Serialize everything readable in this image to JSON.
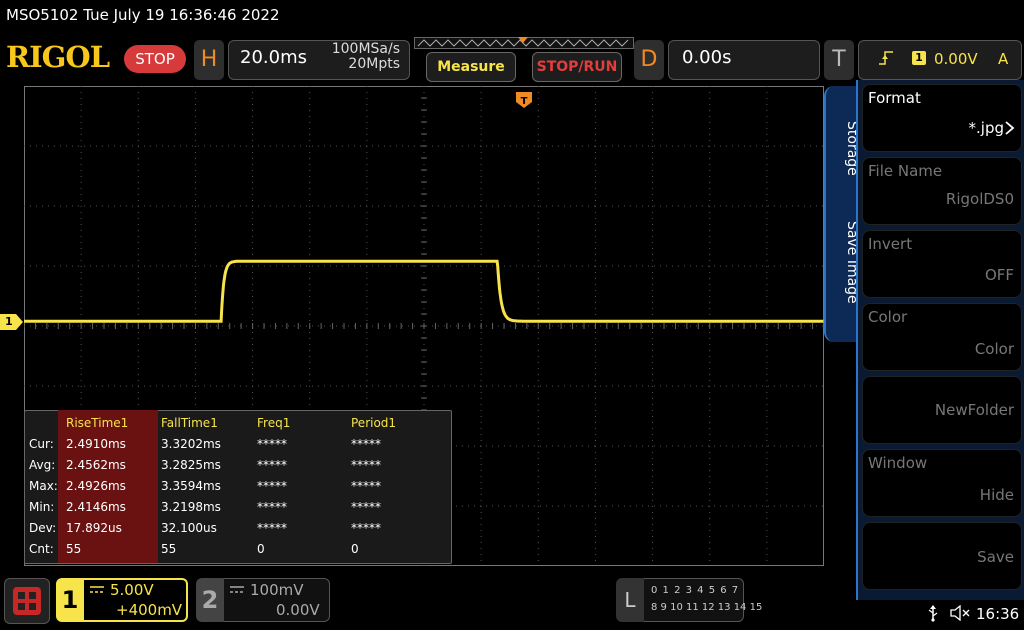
{
  "title_bar": {
    "text": "MSO5102  Tue July 19 16:36:46 2022"
  },
  "brand": {
    "logo": "RIGOL",
    "run_state": "STOP"
  },
  "horizontal": {
    "letter": "H",
    "timebase": "20.0ms",
    "sample_rate": "100MSa/s",
    "memory_depth": "20Mpts"
  },
  "buttons": {
    "measure": "Measure",
    "stop_run": "STOP/RUN"
  },
  "delay": {
    "letter": "D",
    "value": "0.00s"
  },
  "trigger": {
    "letter": "T",
    "source": "1",
    "level": "0.00V",
    "mode": "A"
  },
  "channel_marker": "1",
  "measurements": {
    "headers": [
      "RiseTime1",
      "FallTime1",
      "Freq1",
      "Period1"
    ],
    "rows": [
      {
        "label": "Cur:",
        "values": [
          "2.4910ms",
          "3.3202ms",
          "*****",
          "*****"
        ]
      },
      {
        "label": "Avg:",
        "values": [
          "2.4562ms",
          "3.2825ms",
          "*****",
          "*****"
        ]
      },
      {
        "label": "Max:",
        "values": [
          "2.4926ms",
          "3.3594ms",
          "*****",
          "*****"
        ]
      },
      {
        "label": "Min:",
        "values": [
          "2.4146ms",
          "3.2198ms",
          "*****",
          "*****"
        ]
      },
      {
        "label": "Dev:",
        "values": [
          "17.892us",
          "32.100us",
          "*****",
          "*****"
        ]
      },
      {
        "label": "Cnt:",
        "values": [
          "55",
          "55",
          "0",
          "0"
        ]
      }
    ]
  },
  "side_menu": {
    "tabs": [
      "Storage",
      "Save Image"
    ],
    "items": [
      {
        "title": "Format",
        "value": "*.jpg"
      },
      {
        "title": "File Name",
        "value": "RigolDS0"
      },
      {
        "title": "Invert",
        "value": "OFF"
      },
      {
        "title": "Color",
        "value": "Color"
      },
      {
        "title": "",
        "value": "NewFolder"
      },
      {
        "title": "Window",
        "value": "Hide"
      },
      {
        "title": "",
        "value": "Save"
      }
    ]
  },
  "channels": {
    "ch1": {
      "number": "1",
      "scale": "5.00V",
      "offset": "+400mV",
      "coupling": "DC"
    },
    "ch2": {
      "number": "2",
      "scale": "100mV",
      "offset": "0.00V",
      "coupling": "DC"
    }
  },
  "logic": {
    "letter": "L",
    "row1": "0 1 2 3  4 5 6 7",
    "row2": "8 9 10 11 12 13 14 15"
  },
  "status": {
    "time": "16:36"
  },
  "colors": {
    "ch1": "#f7e44b",
    "accent": "#f08a24",
    "stop": "#d63a3a",
    "menu_blue": "#2e75c8"
  },
  "waveform": {
    "time_per_div_ms": 20,
    "volts_per_div": 5.0,
    "offset_v": 0.4,
    "rise_start_ms": -72.6,
    "fall_start_ms": 25.4,
    "high_v": 5.0,
    "low_v": 0.0
  }
}
